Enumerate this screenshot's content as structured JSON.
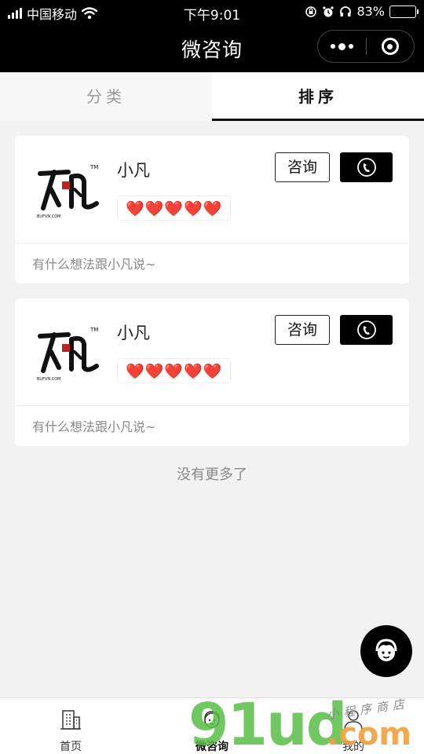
{
  "status_bar": {
    "carrier": "中国移动",
    "time": "下午9:01",
    "battery_percent": "83%",
    "battery_level": 0.83,
    "icons": [
      "signal-icon",
      "wifi-icon",
      "rotation-lock-icon",
      "alarm-icon",
      "headphones-icon",
      "battery-icon"
    ]
  },
  "navbar": {
    "title": "微咨询"
  },
  "tabs": [
    {
      "label": "分类",
      "active": false
    },
    {
      "label": "排序",
      "active": true
    }
  ],
  "consultants": [
    {
      "name": "小凡",
      "hearts": "❤️❤️❤️❤️❤️",
      "consult_label": "咨询",
      "prompt": "有什么想法跟小凡说~",
      "logo_text": "BUFVN.COM"
    },
    {
      "name": "小凡",
      "hearts": "❤️❤️❤️❤️❤️",
      "consult_label": "咨询",
      "prompt": "有什么想法跟小凡说~",
      "logo_text": "BUFVN.COM"
    }
  ],
  "list_end_text": "没有更多了",
  "tabbar": [
    {
      "label": "首页",
      "icon": "building-icon"
    },
    {
      "label": "微咨询",
      "icon": "consultant-icon"
    },
    {
      "label": "我的",
      "icon": "user-icon"
    }
  ],
  "watermark": {
    "main": "91ud",
    "domain": ".com",
    "small": "小程序商店"
  },
  "colors": {
    "nav_bg": "#000000",
    "heart": "#e02828",
    "page_bg": "#f2f2f2"
  }
}
